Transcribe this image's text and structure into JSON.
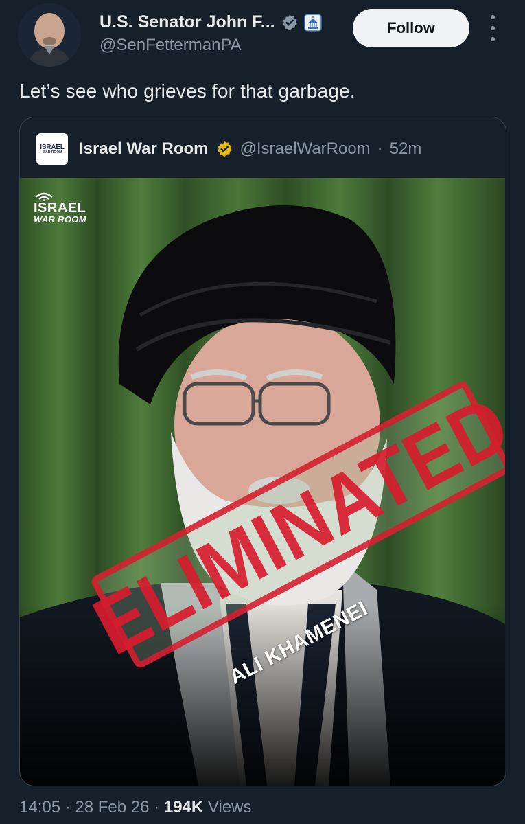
{
  "author": {
    "display_name": "U.S. Senator John F...",
    "handle": "@SenFettermanPA",
    "follow_label": "Follow",
    "verified_icon": "verified-badge-icon",
    "affiliation_icon": "capitol-badge-icon"
  },
  "tweet": {
    "text": "Let’s see who grieves for that garbage."
  },
  "quoted": {
    "avatar_line1": "ISRAEL",
    "avatar_line2": "WAR ROOM",
    "name": "Israel War Room",
    "handle": "@IsraelWarRoom",
    "separator": "·",
    "time": "52m",
    "image": {
      "logo_line1": "ISRAEL",
      "logo_line2": "WAR ROOM",
      "stamp": "ELIMINATED",
      "caption": "ALI KHAMENEI"
    }
  },
  "footer": {
    "time": "14:05",
    "sep1": "·",
    "date": "28 Feb 26",
    "sep2": "·",
    "views_count": "194K",
    "views_label": "Views"
  },
  "colors": {
    "background": "#15202b",
    "text": "#e7e9ea",
    "muted": "#8b98a5",
    "verified_blue": "#8b98a5",
    "gold_badge": "#e2b719",
    "stamp_red": "#d61c2e"
  }
}
